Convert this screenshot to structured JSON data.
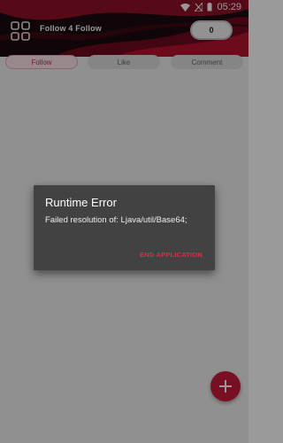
{
  "status_bar": {
    "time": "05:29",
    "icons": [
      "wifi-icon",
      "no-signal-icon",
      "battery-icon"
    ]
  },
  "header": {
    "title": "Follow 4 Follow",
    "coin_count": "0",
    "menu_icon": "grid-icon"
  },
  "tabs": [
    {
      "label": "Follow",
      "active": true
    },
    {
      "label": "Like",
      "active": false
    },
    {
      "label": "Comment",
      "active": false
    }
  ],
  "fab": {
    "icon": "plus-icon"
  },
  "dialog": {
    "title": "Runtime Error",
    "message": "Failed resolution of: Ljava/util/Base64;",
    "button": "END APPLICATION"
  },
  "colors": {
    "accent": "#c8193e",
    "dialog_bg": "#424242",
    "header_dark": "#1b0b0f"
  }
}
